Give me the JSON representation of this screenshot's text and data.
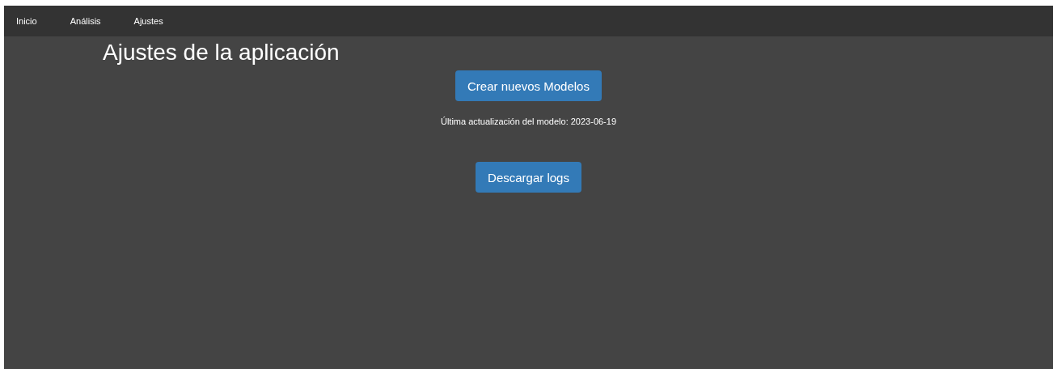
{
  "nav": {
    "items": [
      {
        "label": "Inicio"
      },
      {
        "label": "Análisis"
      },
      {
        "label": "Ajustes"
      }
    ]
  },
  "title": "Ajustes de la aplicación",
  "create_button": "Crear nuevos Modelos",
  "last_update": "Última actualización del modelo: 2023-06-19",
  "download_button": "Descargar logs"
}
